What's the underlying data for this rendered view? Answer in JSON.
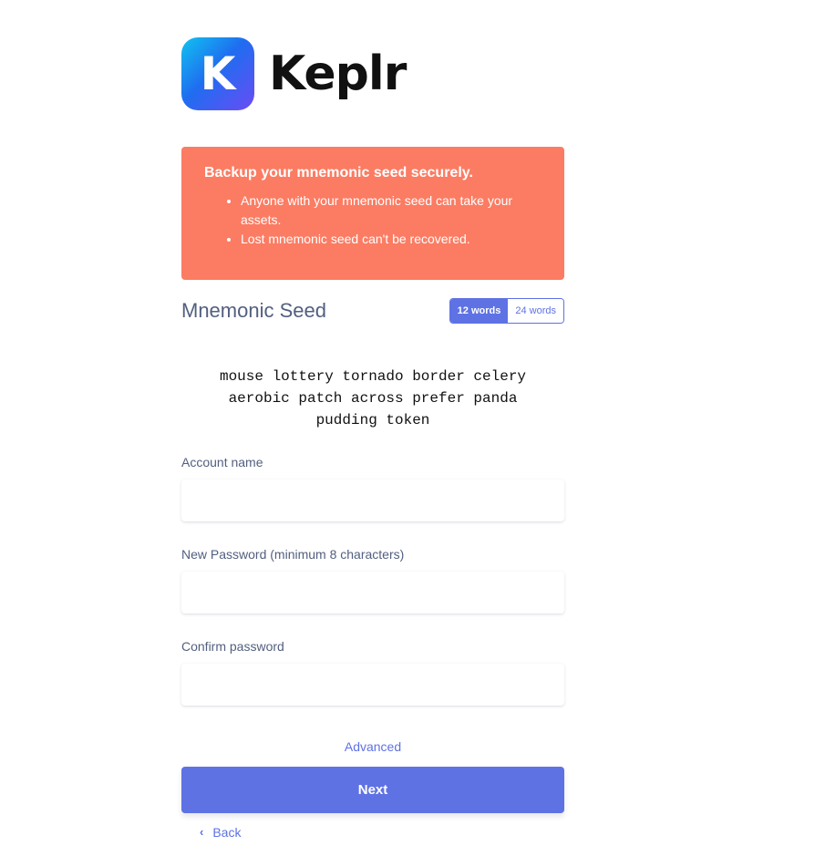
{
  "brand": {
    "icon_letter": "K",
    "name": "Keplr"
  },
  "warning": {
    "title": "Backup your mnemonic seed securely.",
    "items": [
      "Anyone with your mnemonic seed can take your assets.",
      "Lost mnemonic seed can't be recovered."
    ]
  },
  "mnemonic": {
    "title": "Mnemonic Seed",
    "option_12": "12 words",
    "option_24": "24 words",
    "selected": "12 words",
    "words_line1": "mouse lottery tornado border celery",
    "words_line2": "aerobic patch across prefer panda",
    "words_line3": "pudding token"
  },
  "form": {
    "account_name_label": "Account name",
    "account_name_value": "",
    "new_password_label": "New Password (minimum 8 characters)",
    "new_password_value": "",
    "confirm_password_label": "Confirm password",
    "confirm_password_value": ""
  },
  "actions": {
    "advanced": "Advanced",
    "next": "Next",
    "back": "Back"
  },
  "colors": {
    "accent": "#5e72e4",
    "warning_bg": "#fb7c63"
  }
}
